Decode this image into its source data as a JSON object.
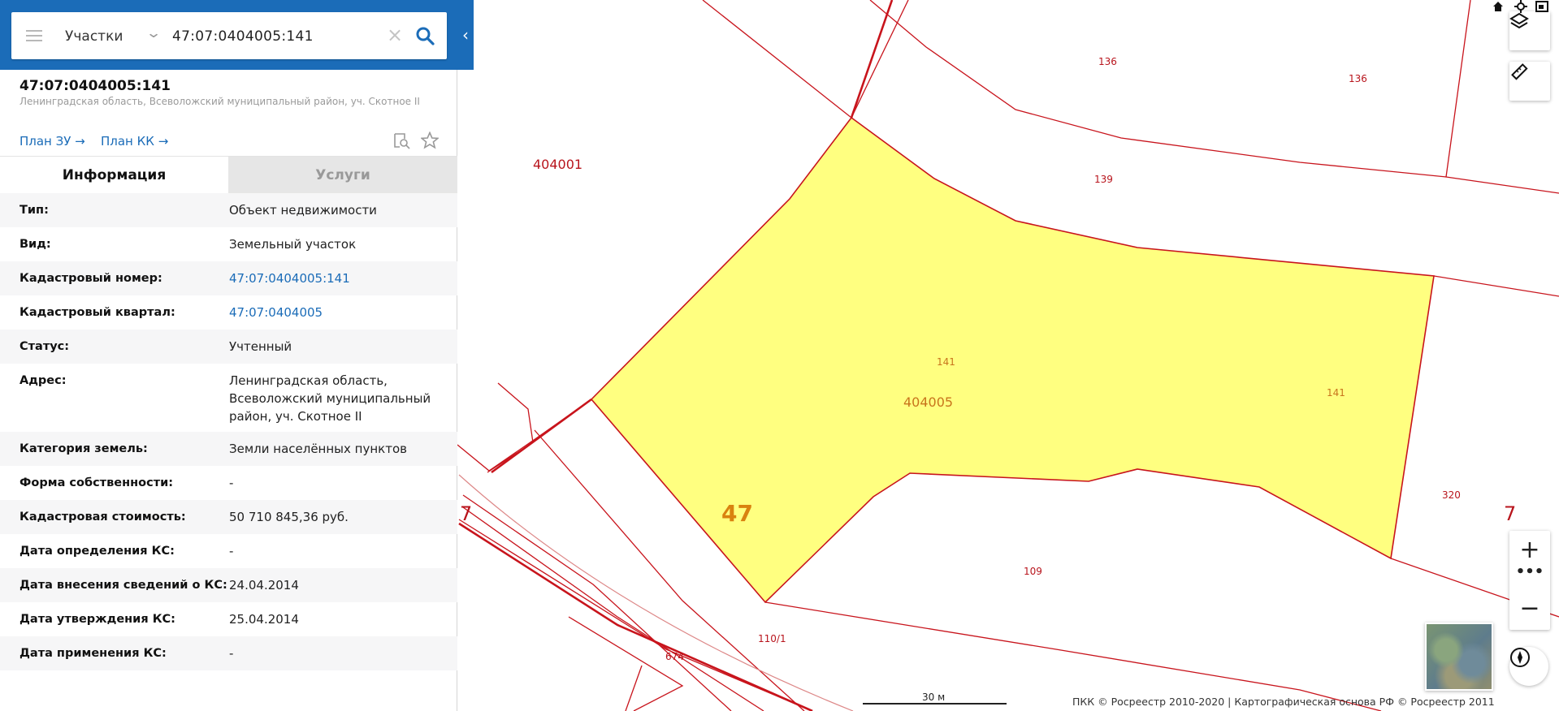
{
  "search": {
    "type": "Участки",
    "value": "47:07:0404005:141"
  },
  "object": {
    "title": "47:07:0404005:141",
    "address": "Ленинградская область, Всеволожский муниципальный район, уч. Скотное II",
    "plan_zu": "План ЗУ →",
    "plan_kk": "План КК →"
  },
  "tabs": {
    "info": "Информация",
    "services": "Услуги"
  },
  "rows": [
    {
      "label": "Тип:",
      "value": "Объект недвижимости"
    },
    {
      "label": "Вид:",
      "value": "Земельный участок"
    },
    {
      "label": "Кадастровый номер:",
      "value": "47:07:0404005:141"
    },
    {
      "label": "Кадастровый квартал:",
      "value": "47:07:0404005"
    },
    {
      "label": "Статус:",
      "value": "Учтенный"
    },
    {
      "label": "Адрес:",
      "value": "Ленинградская область, Всеволожский муниципальный район, уч. Скотное II"
    },
    {
      "label": "Категория земель:",
      "value": "Земли населённых пунктов"
    },
    {
      "label": "Форма собственности:",
      "value": "-"
    },
    {
      "label": "Кадастровая стоимость:",
      "value": "50 710 845,36 руб."
    },
    {
      "label": "Дата определения КС:",
      "value": "-"
    },
    {
      "label": "Дата внесения сведений о КС:",
      "value": "24.04.2014"
    },
    {
      "label": "Дата утверждения КС:",
      "value": "25.04.2014"
    },
    {
      "label": "Дата применения КС:",
      "value": "-"
    }
  ],
  "map": {
    "labels": {
      "q404001": "404001",
      "q404005": "404005",
      "p47": "47",
      "p136a": "136",
      "p136b": "136",
      "p139": "139",
      "p141a": "141",
      "p141b": "141",
      "p320": "320",
      "p7a": "7",
      "p7b": "7",
      "p109": "109",
      "p110": "110/1",
      "p674": "674"
    },
    "scale_label": "30 м",
    "copyright": "ПКК © Росреестр 2010-2020 | Картографическая основа РФ © Росреестр 2011",
    "colors": {
      "parcel_fill": "#ffff80",
      "border": "#c8141c",
      "accent": "#1b6cb8"
    }
  }
}
